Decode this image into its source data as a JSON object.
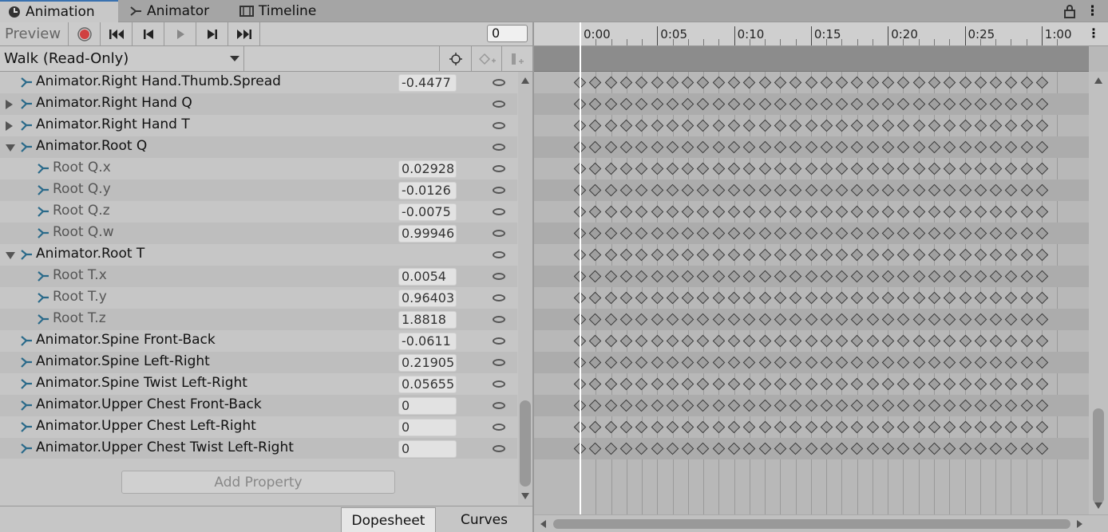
{
  "tabs": [
    {
      "label": "Animation",
      "icon": "animation-clock-icon"
    },
    {
      "label": "Animator",
      "icon": "animator-icon"
    },
    {
      "label": "Timeline",
      "icon": "timeline-film-icon"
    }
  ],
  "toolbar": {
    "preview_label": "Preview",
    "frame_value": "0"
  },
  "clip": {
    "name": "Walk (Read-Only)"
  },
  "properties": [
    {
      "label": "Animator.Right Hand.Thumb.Spread",
      "value": "-0.4477",
      "fold": "none",
      "child": false
    },
    {
      "label": "Animator.Right Hand Q",
      "value": "",
      "fold": "closed",
      "child": false
    },
    {
      "label": "Animator.Right Hand T",
      "value": "",
      "fold": "closed",
      "child": false
    },
    {
      "label": "Animator.Root Q",
      "value": "",
      "fold": "open",
      "child": false
    },
    {
      "label": "Root Q.x",
      "value": "0.02928",
      "fold": "none",
      "child": true
    },
    {
      "label": "Root Q.y",
      "value": "-0.0126",
      "fold": "none",
      "child": true
    },
    {
      "label": "Root Q.z",
      "value": "-0.0075",
      "fold": "none",
      "child": true
    },
    {
      "label": "Root Q.w",
      "value": "0.99946",
      "fold": "none",
      "child": true
    },
    {
      "label": "Animator.Root T",
      "value": "",
      "fold": "open",
      "child": false
    },
    {
      "label": "Root T.x",
      "value": "0.0054",
      "fold": "none",
      "child": true
    },
    {
      "label": "Root T.y",
      "value": "0.96403",
      "fold": "none",
      "child": true
    },
    {
      "label": "Root T.z",
      "value": "1.8818",
      "fold": "none",
      "child": true
    },
    {
      "label": "Animator.Spine Front-Back",
      "value": "-0.0611",
      "fold": "none",
      "child": false
    },
    {
      "label": "Animator.Spine Left-Right",
      "value": "0.21905",
      "fold": "none",
      "child": false
    },
    {
      "label": "Animator.Spine Twist Left-Right",
      "value": "0.05655",
      "fold": "none",
      "child": false
    },
    {
      "label": "Animator.Upper Chest Front-Back",
      "value": "0",
      "fold": "none",
      "child": false
    },
    {
      "label": "Animator.Upper Chest Left-Right",
      "value": "0",
      "fold": "none",
      "child": false
    },
    {
      "label": "Animator.Upper Chest Twist Left-Right",
      "value": "0",
      "fold": "none",
      "child": false
    }
  ],
  "add_property_label": "Add Property",
  "bottom_tabs": {
    "dopesheet": "Dopesheet",
    "curves": "Curves"
  },
  "timeline": {
    "labels": [
      "0:00",
      "0:05",
      "0:10",
      "0:15",
      "0:20",
      "0:25",
      "1:00"
    ],
    "keyframe_count_per_row": 31
  },
  "colors": {
    "record": "#d04040",
    "tab_accent": "#3a72b0"
  }
}
